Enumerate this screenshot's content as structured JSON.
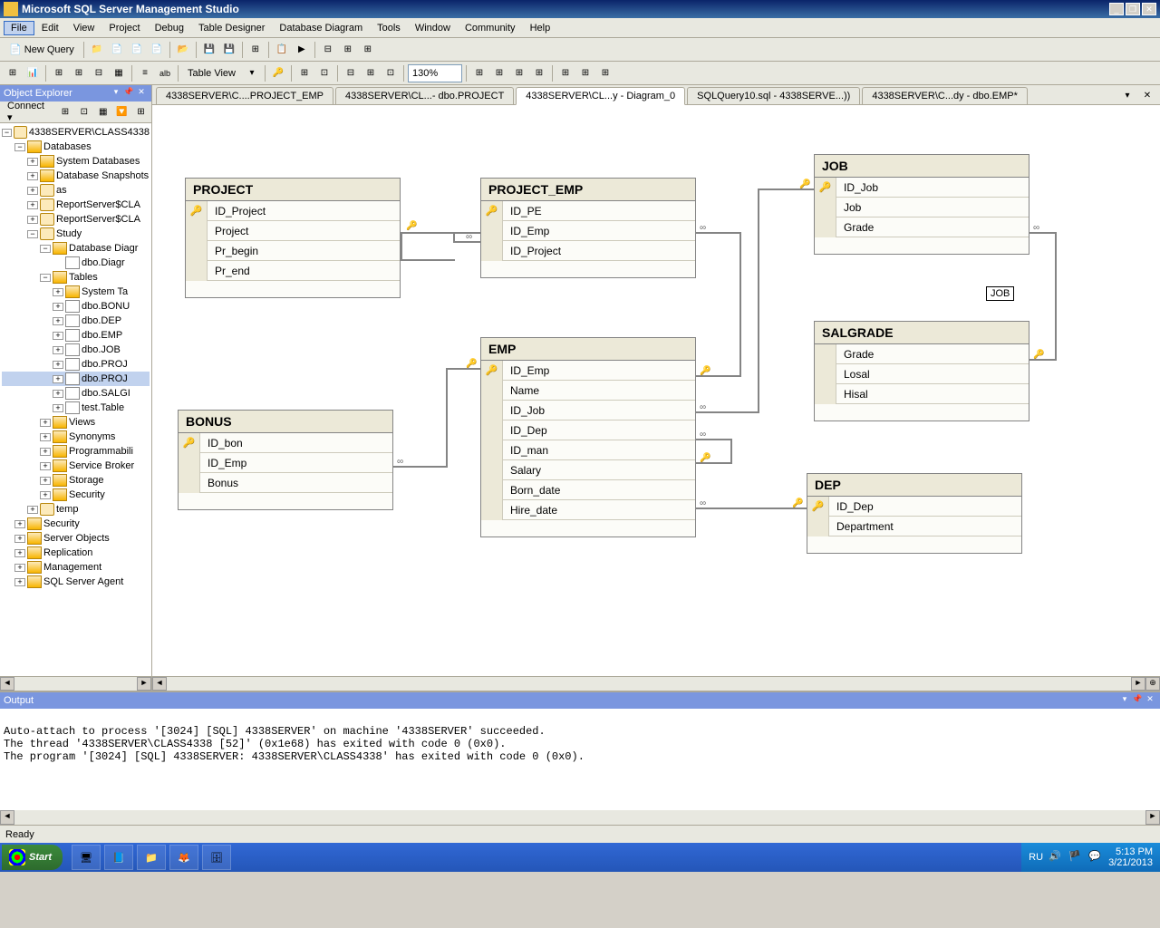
{
  "titlebar": {
    "text": "Microsoft SQL Server Management Studio"
  },
  "menu": [
    "File",
    "Edit",
    "View",
    "Project",
    "Debug",
    "Table Designer",
    "Database Diagram",
    "Tools",
    "Window",
    "Community",
    "Help"
  ],
  "toolbar1": {
    "new_query": "New Query"
  },
  "toolbar2": {
    "table_view": "Table View",
    "zoom": "130%"
  },
  "explorer": {
    "title": "Object Explorer",
    "connect": "Connect",
    "root": "4338SERVER\\CLASS4338",
    "databases": "Databases",
    "nodes": {
      "system_db": "System Databases",
      "snapshots": "Database Snapshots",
      "as": "as",
      "rs1": "ReportServer$CLA",
      "rs2": "ReportServer$CLA",
      "study": "Study",
      "diagrams": "Database Diagr",
      "diag1": "dbo.Diagr",
      "tables": "Tables",
      "system_t": "System Ta",
      "t_bonus": "dbo.BONU",
      "t_dep": "dbo.DEP",
      "t_emp": "dbo.EMP",
      "t_job": "dbo.JOB",
      "t_proj": "dbo.PROJ",
      "t_proj2": "dbo.PROJ",
      "t_salg": "dbo.SALGI",
      "t_test": "test.Table",
      "views": "Views",
      "synonyms": "Synonyms",
      "prog": "Programmabili",
      "sbroker": "Service Broker",
      "storage": "Storage",
      "security_sub": "Security",
      "temp": "temp",
      "security": "Security",
      "server_obj": "Server Objects",
      "replication": "Replication",
      "management": "Management",
      "agent": "SQL Server Agent"
    }
  },
  "tabs": [
    "4338SERVER\\C....PROJECT_EMP",
    "4338SERVER\\CL...- dbo.PROJECT",
    "4338SERVER\\CL...y - Diagram_0",
    "SQLQuery10.sql - 4338SERVE...))",
    "4338SERVER\\C...dy - dbo.EMP*"
  ],
  "active_tab": 2,
  "tables": {
    "project": {
      "name": "PROJECT",
      "cols": [
        "ID_Project",
        "Project",
        "Pr_begin",
        "Pr_end"
      ],
      "keys": [
        0
      ]
    },
    "project_emp": {
      "name": "PROJECT_EMP",
      "cols": [
        "ID_PE",
        "ID_Emp",
        "ID_Project"
      ],
      "keys": [
        0
      ]
    },
    "bonus": {
      "name": "BONUS",
      "cols": [
        "ID_bon",
        "ID_Emp",
        "Bonus"
      ],
      "keys": [
        0
      ]
    },
    "emp": {
      "name": "EMP",
      "cols": [
        "ID_Emp",
        "Name",
        "ID_Job",
        "ID_Dep",
        "ID_man",
        "Salary",
        "Born_date",
        "Hire_date"
      ],
      "keys": [
        0
      ]
    },
    "job": {
      "name": "JOB",
      "cols": [
        "ID_Job",
        "Job",
        "Grade"
      ],
      "keys": [
        0
      ]
    },
    "salgrade": {
      "name": "SALGRADE",
      "cols": [
        "Grade",
        "Losal",
        "Hisal"
      ],
      "keys": []
    },
    "dep": {
      "name": "DEP",
      "cols": [
        "ID_Dep",
        "Department"
      ],
      "keys": [
        0
      ]
    }
  },
  "label_box": "JOB",
  "output": {
    "title": "Output",
    "lines": "\nAuto-attach to process '[3024] [SQL] 4338SERVER' on machine '4338SERVER' succeeded.\nThe thread '4338SERVER\\CLASS4338 [52]' (0x1e68) has exited with code 0 (0x0).\nThe program '[3024] [SQL] 4338SERVER: 4338SERVER\\CLASS4338' has exited with code 0 (0x0).\n"
  },
  "statusbar": {
    "text": "Ready"
  },
  "taskbar": {
    "start": "Start",
    "lang": "RU",
    "time": "5:13 PM",
    "date": "3/21/2013"
  }
}
